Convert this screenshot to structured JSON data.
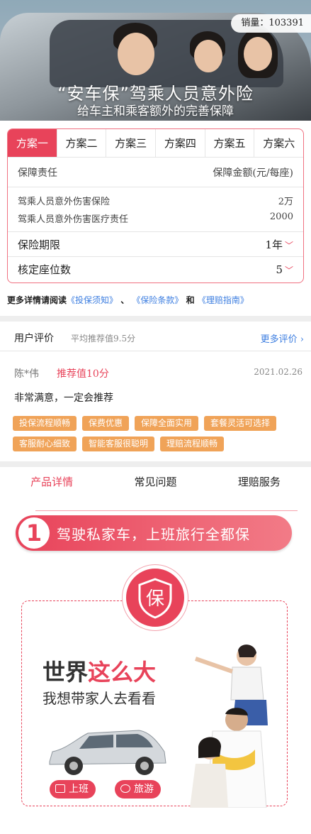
{
  "banner": {
    "sales_label": "销量：103391",
    "title": "“安车保”驾乘人员意外险",
    "subtitle": "给车主和乘客额外的完善保障"
  },
  "plans": {
    "tabs": [
      "方案一",
      "方案二",
      "方案三",
      "方案四",
      "方案五",
      "方案六"
    ],
    "active_index": 0,
    "header_left": "保障责任",
    "header_right": "保障金额(元/每座)",
    "items": [
      {
        "name": "驾乘人员意外伤害保险",
        "value": "2万"
      },
      {
        "name": "驾乘人员意外伤害医疗责任",
        "value": "2000"
      }
    ],
    "period_label": "保险期限",
    "period_value": "1年",
    "seats_label": "核定座位数",
    "seats_value": "5"
  },
  "more_info": {
    "prefix": "更多详情请阅读",
    "link1": "《投保须知》",
    "sep": "、",
    "link2": "《保险条款》",
    "and": "和",
    "link3": "《理赔指南》"
  },
  "reviews": {
    "title": "用户评价",
    "avg": "平均推荐值9.5分",
    "more": "更多评价",
    "name": "陈*伟",
    "score": "推荐值10分",
    "date": "2021.02.26",
    "text": "非常满意，一定会推荐",
    "tags": [
      "投保流程顺畅",
      "保费优惠",
      "保障全面实用",
      "套餐灵活可选择",
      "客服耐心细致",
      "智能客服很聪明",
      "理赔流程顺畅"
    ]
  },
  "detail_tabs": [
    "产品详情",
    "常见问题",
    "理赔服务"
  ],
  "section1": {
    "num": "1",
    "text": "驾驶私家车，上班旅行全都保",
    "badge": "保",
    "headline_a": "世界",
    "headline_b": "这么大",
    "subline": "我想带家人去看看",
    "btn1": "上班",
    "btn2": "旅游"
  },
  "colors": {
    "accent": "#e8435a",
    "tag": "#f0a358",
    "link": "#3b7de0"
  }
}
